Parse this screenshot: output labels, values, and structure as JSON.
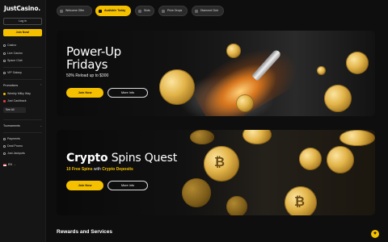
{
  "sidebar": {
    "logo": "JustCasino.",
    "login_label": "Log in",
    "join_label": "Join Now!",
    "nav": [
      {
        "label": "Casino",
        "icon": "casino-icon"
      },
      {
        "label": "Live Casino",
        "icon": "live-casino-icon"
      },
      {
        "label": "Space Club",
        "icon": "space-club-icon"
      }
    ],
    "vip_label": "VIP Galaxy",
    "promotions": {
      "title": "Promotions",
      "items": [
        {
          "label": "Weekly Milky Way",
          "icon": "coin-icon"
        },
        {
          "label": "Just Cashback",
          "icon": "cashback-icon"
        }
      ],
      "see_all": "See All"
    },
    "tournaments_label": "Tournaments",
    "extras": [
      {
        "label": "Payments"
      },
      {
        "label": "Deal Promo"
      },
      {
        "label": "Just Jackpots"
      }
    ],
    "language": "EN"
  },
  "pills": [
    {
      "label": "Welcome Offer",
      "active": false
    },
    {
      "label": "Available Today",
      "active": true
    },
    {
      "label": "Slots",
      "active": false
    },
    {
      "label": "Prize Drops",
      "active": false
    },
    {
      "label": "Diamond Club",
      "active": false
    }
  ],
  "banners": [
    {
      "title_line1": "Power-Up",
      "title_line2": "Fridays",
      "subtitle": "50% Reload up to $300",
      "join": "Join Now",
      "info": "More Info"
    },
    {
      "title_bold": "Crypto",
      "title_rest": " Spins Quest",
      "subtitle_highlight": "10 Free Spins",
      "subtitle_mid": " with ",
      "subtitle_highlight2": "Crypto Deposits",
      "join": "Join Now",
      "info": "More Info"
    }
  ],
  "section_title": "Rewards and Services",
  "colors": {
    "accent": "#f5c000",
    "background": "#0e0e0e",
    "sidebar": "#151515"
  }
}
